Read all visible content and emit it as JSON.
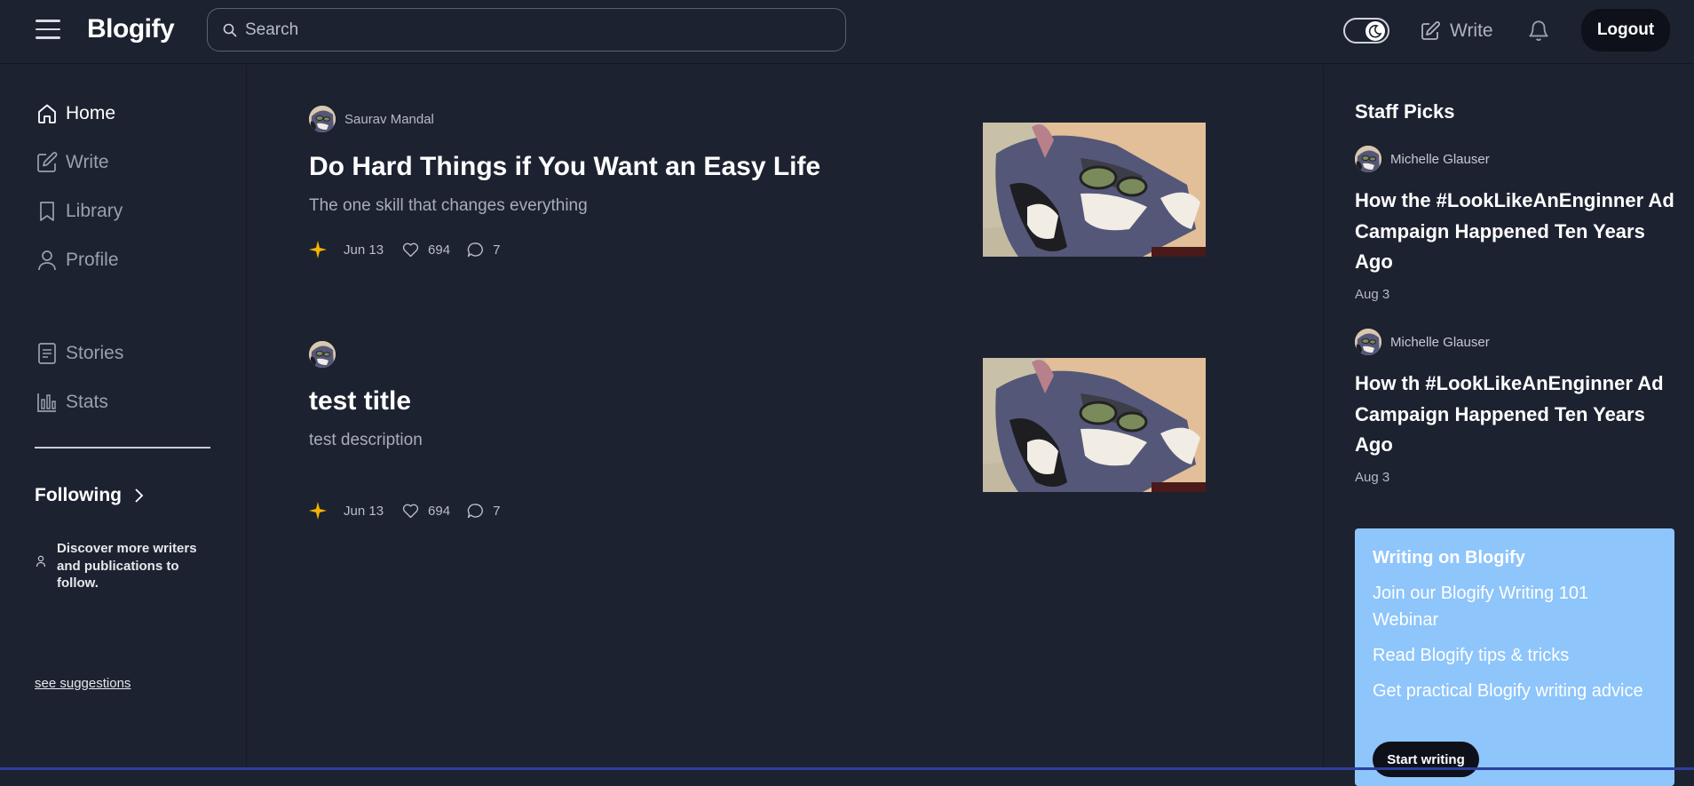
{
  "brand": {
    "name": "Blogify"
  },
  "search": {
    "placeholder": "Search"
  },
  "header": {
    "write_label": "Write",
    "logout_label": "Logout",
    "theme": "dark"
  },
  "sidebar": {
    "items": [
      {
        "label": "Home",
        "icon": "home-icon",
        "active": true
      },
      {
        "label": "Write",
        "icon": "edit-icon"
      },
      {
        "label": "Library",
        "icon": "bookmark-icon"
      },
      {
        "label": "Profile",
        "icon": "user-icon"
      },
      {
        "label": "Stories",
        "icon": "document-icon"
      },
      {
        "label": "Stats",
        "icon": "bar-chart-icon"
      }
    ],
    "following_label": "Following",
    "discover_text": "Discover more writers and publications to follow.",
    "see_suggestions": "see suggestions"
  },
  "feed": {
    "posts": [
      {
        "author": "Saurav Mandal",
        "title": "Do Hard Things if You Want an Easy Life",
        "description": "The one skill that changes everything",
        "date": "Jun 13",
        "likes": "694",
        "comments": "7"
      },
      {
        "author": "",
        "title": "test title",
        "description": "test description",
        "date": "Jun 13",
        "likes": "694",
        "comments": "7"
      }
    ]
  },
  "staff_picks": {
    "title": "Staff Picks",
    "items": [
      {
        "author": "Michelle Glauser",
        "title": "How the #LookLikeAnEnginner Ad Campaign Happened Ten Years Ago",
        "date": "Aug 3"
      },
      {
        "author": "Michelle Glauser",
        "title": "How th #LookLikeAnEnginner Ad Campaign Happened Ten Years Ago",
        "date": "Aug 3"
      }
    ]
  },
  "writing_box": {
    "heading": "Writing on Blogify",
    "links": [
      "Join our Blogify Writing 101 Webinar",
      "Read Blogify tips & tricks",
      "Get practical Blogify writing advice"
    ],
    "button": "Start writing",
    "color": "#8ec5fb"
  },
  "colors": {
    "background": "#1c2230",
    "star": "#f5b400",
    "button_dark": "#0e1119"
  }
}
